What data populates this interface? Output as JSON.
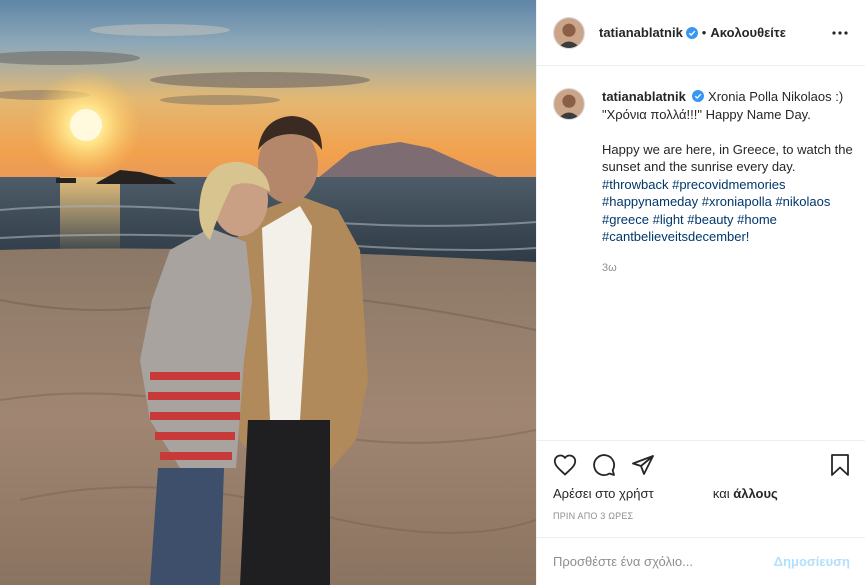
{
  "post": {
    "username": "tatianablatnik",
    "separator": "•",
    "follow_status": "Ακολουθείτε",
    "caption_first": "Xronia Polla Nikolaos :)",
    "caption_quote": "\"Χρόνια πολλά!!!\" Happy Name Day.",
    "caption_body": "Happy we are here, in Greece, to watch the sunset and the sunrise every day.",
    "hashtags": "#throwback #precovidmemories #happynameday #xroniapolla #nikolaos #greece #light #beauty #home #cantbelieveitsdecember!",
    "time_ago": "3ω"
  },
  "likes": {
    "prefix": "Αρέσει στο χρήστ",
    "suffix_and": "και",
    "suffix_others": "άλλους"
  },
  "posted_time": "ΠΡΙΝ ΑΠΟ 3 ΩΡΕΣ",
  "comment": {
    "placeholder": "Προσθέστε ένα σχόλιο...",
    "publish_label": "Δημοσίευση"
  },
  "icons": {
    "verified": "verified-badge-icon",
    "more": "more-options-icon",
    "like": "heart-icon",
    "comment": "comment-bubble-icon",
    "share": "share-plane-icon",
    "save": "bookmark-icon"
  },
  "colors": {
    "accent_blue": "#0095f6",
    "verified_blue": "#3897f0",
    "hashtag_blue": "#00376b",
    "publish_disabled": "#b2dffc",
    "muted_gray": "#8e8e8e"
  }
}
